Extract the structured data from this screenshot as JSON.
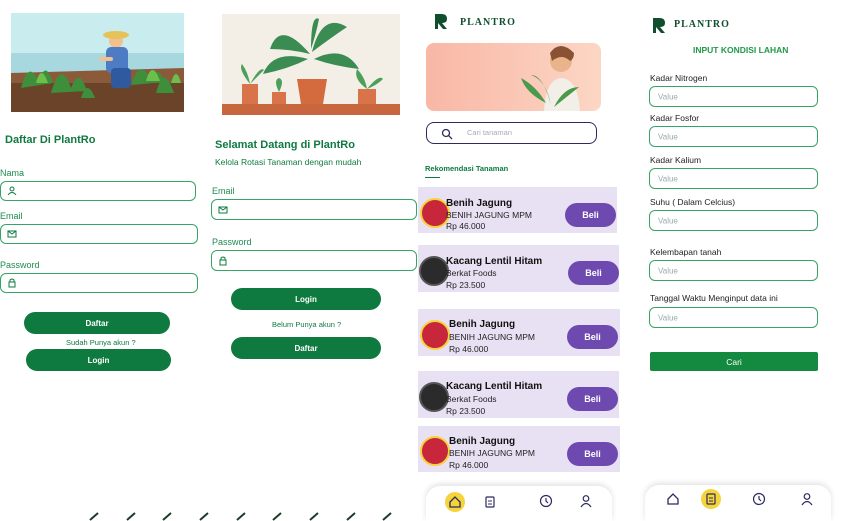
{
  "screen1": {
    "title": "Daftar Di PlantRo",
    "fields": [
      {
        "label": "Nama",
        "icon": "user-icon"
      },
      {
        "label": "Email",
        "icon": "mail-icon"
      },
      {
        "label": "Password",
        "icon": "lock-icon"
      }
    ],
    "primary_button": "Daftar",
    "link_text": "Sudah Punya akun ?",
    "secondary_button": "Login"
  },
  "screen2": {
    "title": "Selamat Datang di PlantRo",
    "subtitle": "Kelola Rotasi Tanaman dengan mudah",
    "fields": [
      {
        "label": "Email",
        "icon": "mail-icon"
      },
      {
        "label": "Password",
        "icon": "lock-icon"
      }
    ],
    "primary_button": "Login",
    "link_text": "Belum Punya akun ?",
    "secondary_button": "Daftar"
  },
  "screen3": {
    "brand": "PLANTRO",
    "search_placeholder": "Cari tanaman",
    "section_title": "Rekomendasi Tanaman",
    "buy_label": "Beli",
    "products": [
      {
        "name": "Benih Jagung",
        "brand": "BENIH JAGUNG MPM",
        "price": "Rp 46.000",
        "kind": "corn"
      },
      {
        "name": "Kacang Lentil Hitam",
        "brand": "Berkat Foods",
        "price": "Rp 23.500",
        "kind": "lentil"
      },
      {
        "name": "Benih Jagung",
        "brand": "BENIH JAGUNG MPM",
        "price": "Rp 46.000",
        "kind": "corn"
      },
      {
        "name": "Kacang Lentil Hitam",
        "brand": "Berkat Foods",
        "price": "Rp 23.500",
        "kind": "lentil"
      },
      {
        "name": "Benih Jagung",
        "brand": "BENIH JAGUNG MPM",
        "price": "Rp 46.000",
        "kind": "corn"
      }
    ],
    "nav": [
      "home-icon",
      "clipboard-icon",
      "clock-icon",
      "profile-icon"
    ],
    "active_nav": 0
  },
  "screen4": {
    "brand": "PLANTRO",
    "title": "INPUT KONDISI LAHAN",
    "fields": [
      {
        "label": "Kadar Nitrogen",
        "placeholder": "Value"
      },
      {
        "label": "Kadar Fosfor",
        "placeholder": "Value"
      },
      {
        "label": "Kadar Kalium",
        "placeholder": "Value"
      },
      {
        "label": "Suhu ( Dalam Celcius)",
        "placeholder": "Value"
      },
      {
        "label": "Kelembapan tanah",
        "placeholder": "Value"
      },
      {
        "label": "Tanggal Waktu Menginput data ini",
        "placeholder": "Value"
      }
    ],
    "submit": "Cari",
    "nav": [
      "home-icon",
      "clipboard-icon",
      "clock-icon",
      "profile-icon"
    ],
    "active_nav": 1
  },
  "colors": {
    "primary_green": "#0f7a3f",
    "purple": "#6e4ab0",
    "card_bg": "#e8e1f3",
    "accent_yellow": "#f5d33a"
  }
}
